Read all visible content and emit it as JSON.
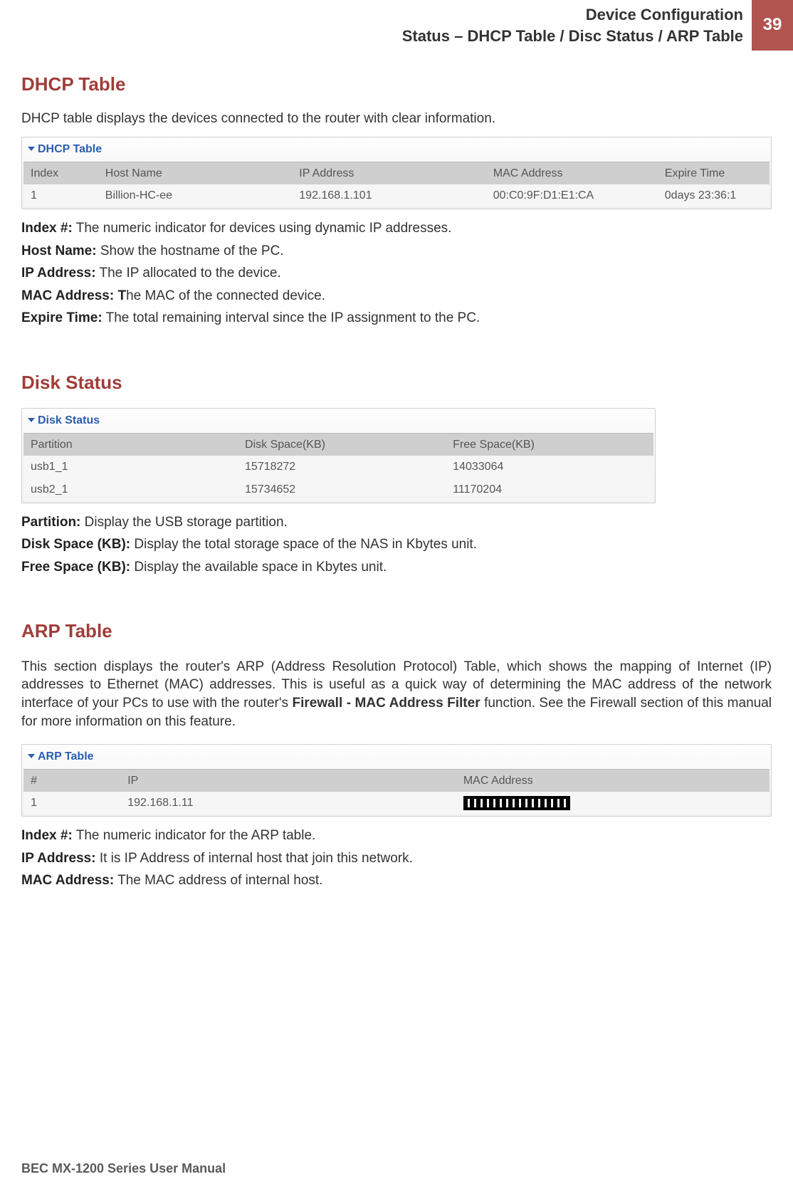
{
  "header": {
    "line1": "Device Configuration",
    "line2": "Status – DHCP Table / Disc Status / ARP Table",
    "page_number": "39"
  },
  "dhcp": {
    "heading": "DHCP Table",
    "intro": "DHCP table displays the devices connected to the router with clear information.",
    "panel_title": "DHCP Table",
    "columns": {
      "index": "Index",
      "host": "Host Name",
      "ip": "IP Address",
      "mac": "MAC Address",
      "expire": "Expire Time"
    },
    "row": {
      "index": "1",
      "host": "Billion-HC-ee",
      "ip": "192.168.1.101",
      "mac": "00:C0:9F:D1:E1:CA",
      "expire": "0days 23:36:1"
    },
    "defs": {
      "index_label": "Index #:",
      "index_text": " The numeric indicator for devices using dynamic IP addresses.",
      "host_label": "Host Name:",
      "host_text": " Show the hostname of the PC.",
      "ip_label": "IP Address:",
      "ip_text": " The IP allocated to the device.",
      "mac_label": "MAC Address: T",
      "mac_text": "he MAC of the connected device.",
      "expire_label": "Expire Time:",
      "expire_text": " The total remaining interval since the IP assignment to the PC."
    }
  },
  "disk": {
    "heading": "Disk Status",
    "panel_title": "Disk Status",
    "columns": {
      "partition": "Partition",
      "diskspace": "Disk Space(KB)",
      "freespace": "Free Space(KB)"
    },
    "rows": [
      {
        "partition": "usb1_1",
        "diskspace": "15718272",
        "freespace": "14033064"
      },
      {
        "partition": "usb2_1",
        "diskspace": "15734652",
        "freespace": "11170204"
      }
    ],
    "defs": {
      "partition_label": "Partition:",
      "partition_text": " Display the USB storage partition.",
      "diskspace_label": "Disk Space (KB):",
      "diskspace_text": " Display the total storage space of the NAS in Kbytes unit.",
      "freespace_label": "Free Space (KB):",
      "freespace_text": " Display the available space in Kbytes unit."
    }
  },
  "arp": {
    "heading": "ARP Table",
    "intro_part1": "This section displays the router's ARP (Address Resolution Protocol) Table, which shows the mapping of Internet (IP) addresses to Ethernet (MAC) addresses. This is useful as a quick way of determining the MAC address of the network interface of your PCs to use with the router's ",
    "intro_bold": "Firewall - MAC Address Filter",
    "intro_part2": " function. See the Firewall section of this manual for more information on this feature.",
    "panel_title": "ARP Table",
    "columns": {
      "num": "#",
      "ip": "IP",
      "mac": "MAC Address"
    },
    "row": {
      "num": "1",
      "ip": "192.168.1.11"
    },
    "defs": {
      "index_label": "Index #:",
      "index_text": " The numeric indicator for the ARP table.",
      "ip_label": "IP Address:",
      "ip_text": " It is IP Address of internal host that join this network.",
      "mac_label": "MAC Address:",
      "mac_text": " The MAC address of internal host."
    }
  },
  "footer": "BEC MX-1200 Series User Manual"
}
